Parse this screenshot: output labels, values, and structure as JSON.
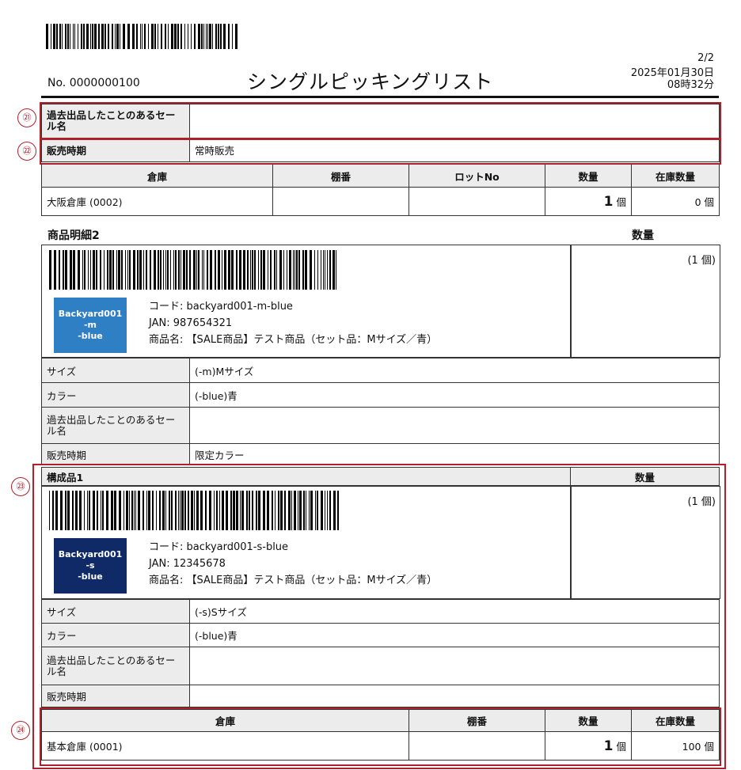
{
  "header": {
    "doc_no": "No. 0000000100",
    "title": "シングルピッキングリスト",
    "page": "2/2",
    "date": "2025年01月30日",
    "time": "08時32分"
  },
  "markers": {
    "m21": "㉑",
    "m22": "㉒",
    "m23": "㉓",
    "m24": "㉔"
  },
  "top_attrs": {
    "past_sale_label": "過去出品したことのあるセール名",
    "past_sale_value": "",
    "period_label": "販売時期",
    "period_value": "常時販売"
  },
  "stock_table_1": {
    "headers": [
      "倉庫",
      "棚番",
      "ロットNo",
      "数量",
      "在庫数量"
    ],
    "row": {
      "warehouse": "大阪倉庫 (0002)",
      "shelf": "",
      "lot": "",
      "qty": "1",
      "qty_unit": "個",
      "stock": "0 個"
    }
  },
  "detail2": {
    "title": "商品明細2",
    "qty_header": "数量",
    "qty_value": "(1 個)",
    "thumb_lines": [
      "Backyard001",
      "-m",
      "-blue"
    ],
    "thumb_color": "#2f7fc4",
    "code": "コード: backyard001-m-blue",
    "jan": "JAN: 987654321",
    "name": "商品名: 【SALE商品】テスト商品（セット品：Mサイズ／青）",
    "size_label": "サイズ",
    "size_value": "(-m)Mサイズ",
    "color_label": "カラー",
    "color_value": "(-blue)青",
    "past_sale_label": "過去出品したことのあるセール名",
    "past_sale_value": "",
    "period_label": "販売時期",
    "period_value": "限定カラー"
  },
  "component1": {
    "title": "構成品1",
    "qty_header": "数量",
    "qty_value": "(1 個)",
    "thumb_lines": [
      "Backyard001",
      "-s",
      "-blue"
    ],
    "thumb_color": "#0f2a66",
    "code": "コード: backyard001-s-blue",
    "jan": "JAN: 12345678",
    "name": "商品名: 【SALE商品】テスト商品（セット品：Mサイズ／青）",
    "size_label": "サイズ",
    "size_value": "(-s)Sサイズ",
    "color_label": "カラー",
    "color_value": "(-blue)青",
    "past_sale_label": "過去出品したことのあるセール名",
    "past_sale_value": "",
    "period_label": "販売時期",
    "period_value": ""
  },
  "stock_table_2": {
    "headers": [
      "倉庫",
      "棚番",
      "数量",
      "在庫数量"
    ],
    "row": {
      "warehouse": "基本倉庫 (0001)",
      "shelf": "",
      "qty": "1",
      "qty_unit": "個",
      "stock": "100 個"
    }
  },
  "colors": {
    "annotation_red": "#b0202a",
    "header_gray": "#ececec"
  }
}
